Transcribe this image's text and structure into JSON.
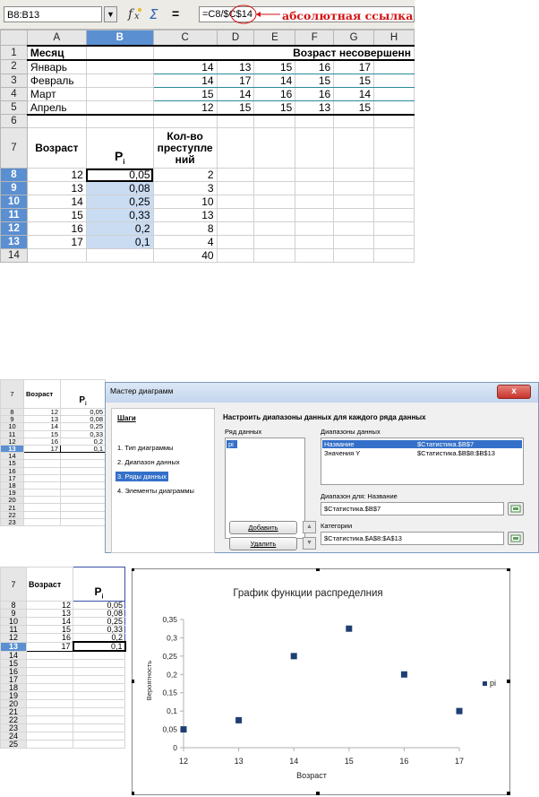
{
  "panel1": {
    "name_box": "B8:B13",
    "formula": "=C8/$C$14",
    "annotation": "абсолютная ссылка",
    "columns": [
      "A",
      "B",
      "C",
      "D",
      "E",
      "F",
      "G",
      "H"
    ],
    "rows": [
      {
        "n": "1",
        "a": "Месяц",
        "b": "",
        "rest": "Возраст несовершенн"
      },
      {
        "n": "2",
        "a": "Январь",
        "b": "",
        "c": "14",
        "d": "13",
        "e": "15",
        "f": "16",
        "g": "17"
      },
      {
        "n": "3",
        "a": "Февраль",
        "b": "",
        "c": "14",
        "d": "17",
        "e": "14",
        "f": "15",
        "g": "15"
      },
      {
        "n": "4",
        "a": "Март",
        "b": "",
        "c": "15",
        "d": "14",
        "e": "16",
        "f": "16",
        "g": "14"
      },
      {
        "n": "5",
        "a": "Апрель",
        "b": "",
        "c": "12",
        "d": "15",
        "e": "15",
        "f": "13",
        "g": "15"
      },
      {
        "n": "6"
      },
      {
        "n": "7",
        "a": "Возраст",
        "b": "P",
        "b_sub": "i",
        "c": "Кол-во преступле ний"
      },
      {
        "n": "8",
        "a": "12",
        "b": "0,05",
        "c": "2"
      },
      {
        "n": "9",
        "a": "13",
        "b": "0,08",
        "c": "3"
      },
      {
        "n": "10",
        "a": "14",
        "b": "0,25",
        "c": "10"
      },
      {
        "n": "11",
        "a": "15",
        "b": "0,33",
        "c": "13"
      },
      {
        "n": "12",
        "a": "16",
        "b": "0,2",
        "c": "8"
      },
      {
        "n": "13",
        "a": "17",
        "b": "0,1",
        "c": "4"
      },
      {
        "n": "14",
        "a": "",
        "b": "",
        "c": "40"
      }
    ]
  },
  "panel2": {
    "sheet_header_a": "Возраст",
    "sheet_header_b": "P",
    "sheet_header_b_sub": "i",
    "sheet_rows": [
      {
        "n": "7"
      },
      {
        "n": "8",
        "a": "12",
        "b": "0,05"
      },
      {
        "n": "9",
        "a": "13",
        "b": "0,08"
      },
      {
        "n": "10",
        "a": "14",
        "b": "0,25"
      },
      {
        "n": "11",
        "a": "15",
        "b": "0,33"
      },
      {
        "n": "12",
        "a": "16",
        "b": "0,2"
      },
      {
        "n": "13",
        "a": "17",
        "b": "0,1"
      },
      {
        "n": "14"
      },
      {
        "n": "15"
      },
      {
        "n": "16"
      },
      {
        "n": "17"
      },
      {
        "n": "18"
      },
      {
        "n": "19"
      },
      {
        "n": "20"
      },
      {
        "n": "21"
      },
      {
        "n": "22"
      },
      {
        "n": "23"
      }
    ],
    "wizard": {
      "title": "Мастер диаграмм",
      "close": "x",
      "steps_title": "Шаги",
      "steps": [
        "1. Тип диаграммы",
        "2. Диапазон данных",
        "3. Ряды данных",
        "4. Элементы диаграммы"
      ],
      "heading": "Настроить диапазоны данных для каждого ряда данных",
      "series_label": "Ряд данных",
      "series_items": [
        "pi"
      ],
      "ranges_label": "Диапазоны данных",
      "ranges": [
        {
          "name": "Название",
          "value": "$Статистика.$B$7"
        },
        {
          "name": "Значения Y",
          "value": "$Статистика.$B$8:$B$13"
        }
      ],
      "range_for_label": "Диапазон для: Название",
      "range_for_value": "$Статистика.$B$7",
      "categories_label": "Категории",
      "categories_value": "$Статистика.$A$8:$A$13",
      "add_button": "Добавить",
      "delete_button": "Удалить"
    }
  },
  "panel3": {
    "sheet_header_a": "Возраст",
    "sheet_header_b": "P",
    "sheet_header_b_sub": "i",
    "sheet_rows": [
      {
        "n": "7"
      },
      {
        "n": "8",
        "a": "12",
        "b": "0,05"
      },
      {
        "n": "9",
        "a": "13",
        "b": "0,08"
      },
      {
        "n": "10",
        "a": "14",
        "b": "0,25"
      },
      {
        "n": "11",
        "a": "15",
        "b": "0,33"
      },
      {
        "n": "12",
        "a": "16",
        "b": "0,2"
      },
      {
        "n": "13",
        "a": "17",
        "b": "0,1"
      },
      {
        "n": "14"
      },
      {
        "n": "15"
      },
      {
        "n": "16"
      },
      {
        "n": "17"
      },
      {
        "n": "18"
      },
      {
        "n": "19"
      },
      {
        "n": "20"
      },
      {
        "n": "21"
      },
      {
        "n": "22"
      },
      {
        "n": "23"
      },
      {
        "n": "24"
      },
      {
        "n": "25"
      }
    ]
  },
  "chart_data": {
    "type": "scatter",
    "title": "График функции распределния",
    "xlabel": "Возраст",
    "ylabel": "Вероятность",
    "x": [
      12,
      13,
      14,
      15,
      16,
      17
    ],
    "series": [
      {
        "name": "pi",
        "values": [
          0.05,
          0.075,
          0.25,
          0.325,
          0.2,
          0.1
        ]
      }
    ],
    "xlim": [
      12,
      17
    ],
    "ylim": [
      0,
      0.35
    ],
    "x_ticks": [
      "12",
      "13",
      "14",
      "15",
      "16",
      "17"
    ],
    "y_ticks": [
      "0",
      "0,05",
      "0,1",
      "0,15",
      "0,2",
      "0,25",
      "0,3",
      "0,35"
    ],
    "grid": false,
    "legend": "right",
    "marker_color": "#1f3f73"
  }
}
